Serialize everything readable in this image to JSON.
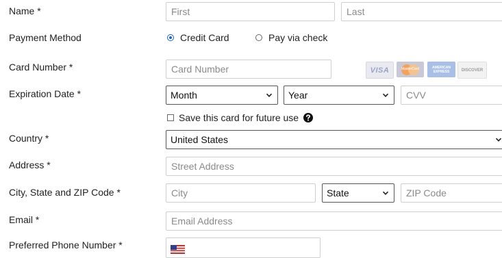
{
  "labels": {
    "name": "Name  *",
    "payment_method": "Payment Method",
    "card_number": "Card Number  *",
    "expiration_date": "Expiration Date  *",
    "country": "Country  *",
    "address": "Address  *",
    "city_state_zip": "City, State and ZIP Code  *",
    "email": "Email  *",
    "phone": "Preferred Phone Number  *"
  },
  "fields": {
    "first_placeholder": "First",
    "last_placeholder": "Last",
    "card_number_placeholder": "Card Number",
    "cvv_placeholder": "CVV",
    "street_placeholder": "Street Address",
    "city_placeholder": "City",
    "zip_placeholder": "ZIP Code",
    "email_placeholder": "Email Address"
  },
  "payment": {
    "option_credit": "Credit Card",
    "option_check": "Pay via check",
    "selected": "Credit Card"
  },
  "selects": {
    "month": "Month",
    "year": "Year",
    "country": "United States",
    "state": "State"
  },
  "save_card": {
    "label": "Save this card for future use",
    "checked": false
  },
  "card_logos": {
    "visa": "VISA",
    "mastercard": "MasterCard",
    "amex": "AMERICAN EXPRESS",
    "discover": "DISCOVER"
  },
  "phone": {
    "flag": "us-flag-icon"
  },
  "colors": {
    "accent": "#1a63c9",
    "input_border": "#cfcfcf",
    "select_border": "#555555"
  }
}
